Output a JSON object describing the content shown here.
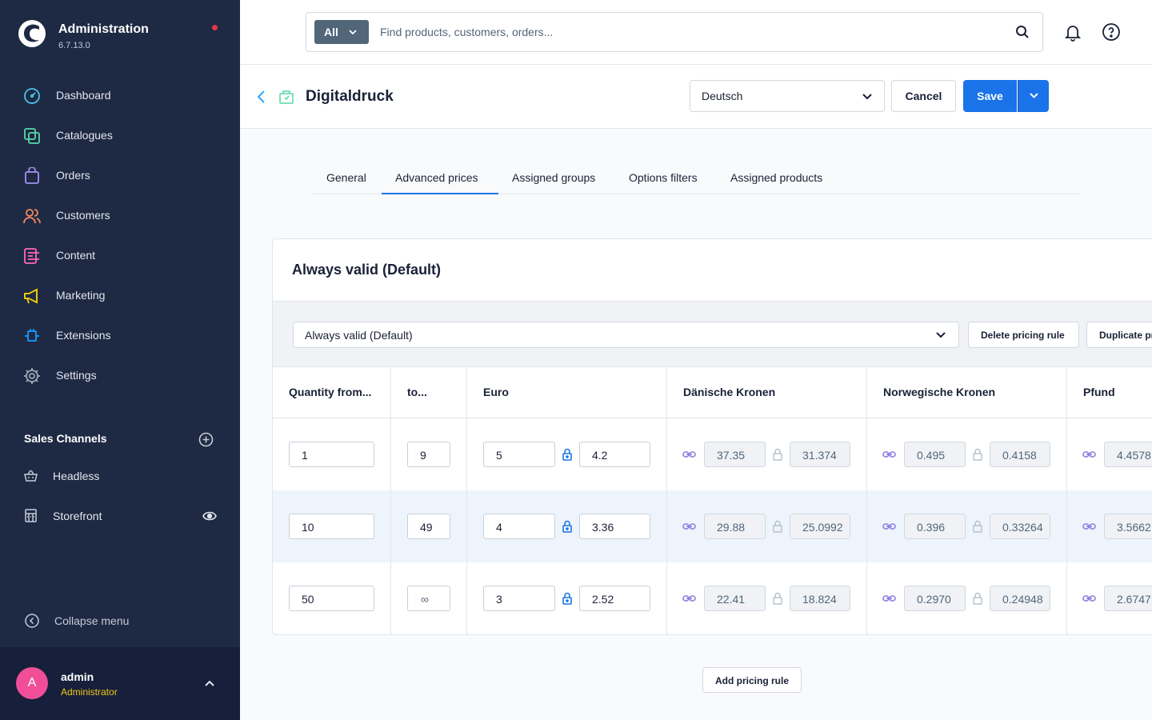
{
  "app": {
    "title": "Administration",
    "version": "6.7.13.0"
  },
  "sidebar": {
    "items": [
      {
        "label": "Dashboard",
        "icon": "dashboard-icon",
        "color": "#4fc1e9"
      },
      {
        "label": "Catalogues",
        "icon": "catalogue-icon",
        "color": "#57d9a3"
      },
      {
        "label": "Orders",
        "icon": "orders-icon",
        "color": "#a092f0"
      },
      {
        "label": "Customers",
        "icon": "customers-icon",
        "color": "#f88962"
      },
      {
        "label": "Content",
        "icon": "content-icon",
        "color": "#ff68b4"
      },
      {
        "label": "Marketing",
        "icon": "marketing-icon",
        "color": "#ffd700"
      },
      {
        "label": "Extensions",
        "icon": "extensions-icon",
        "color": "#189eff"
      },
      {
        "label": "Settings",
        "icon": "settings-icon",
        "color": "#9aa8b5"
      }
    ],
    "sales_channels_title": "Sales Channels",
    "sales_channels": [
      {
        "label": "Headless",
        "icon": "basket-icon"
      },
      {
        "label": "Storefront",
        "icon": "storefront-icon"
      }
    ],
    "collapse_label": "Collapse menu",
    "user": {
      "initial": "A",
      "name": "admin",
      "role": "Administrator"
    }
  },
  "header": {
    "search_type": "All",
    "search_placeholder": "Find products, customers, orders..."
  },
  "smartbar": {
    "title": "Digitaldruck",
    "language": "Deutsch",
    "cancel_label": "Cancel",
    "save_label": "Save"
  },
  "tabs": [
    {
      "label": "General",
      "active": false
    },
    {
      "label": "Advanced prices",
      "active": true
    },
    {
      "label": "Assigned groups",
      "active": false
    },
    {
      "label": "Options filters",
      "active": false
    },
    {
      "label": "Assigned products",
      "active": false
    }
  ],
  "pricing": {
    "card_title": "Always valid (Default)",
    "rule_selected": "Always valid (Default)",
    "delete_rule_label": "Delete pricing rule",
    "duplicate_rule_label": "Duplicate pricing rule",
    "columns": [
      "Quantity from...",
      "to...",
      "Euro",
      "Dänische Kronen",
      "Norwegische Kronen",
      "Pfund"
    ],
    "rows": [
      {
        "from": "1",
        "to": "9",
        "euro_gross": "5",
        "euro_net": "4.2",
        "dkk_gross": "37.35",
        "dkk_net": "31.374",
        "nok_gross": "0.495",
        "nok_net": "0.4158",
        "gbp_gross": "4.4578"
      },
      {
        "from": "10",
        "to": "49",
        "euro_gross": "4",
        "euro_net": "3.36",
        "dkk_gross": "29.88",
        "dkk_net": "25.0992",
        "nok_gross": "0.396",
        "nok_net": "0.33264",
        "gbp_gross": "3.5662"
      },
      {
        "from": "50",
        "to": "∞",
        "euro_gross": "3",
        "euro_net": "2.52",
        "dkk_gross": "22.41",
        "dkk_net": "18.824",
        "nok_gross": "0.2970",
        "nok_net": "0.24948",
        "gbp_gross": "2.6747"
      }
    ],
    "add_rule_label": "Add pricing rule"
  },
  "colors": {
    "sidebar_bg": "#1e2a44",
    "primary": "#1a73e8",
    "notification_dot": "#e5324b",
    "avatar": "#f04e98",
    "role": "#f5c518"
  }
}
